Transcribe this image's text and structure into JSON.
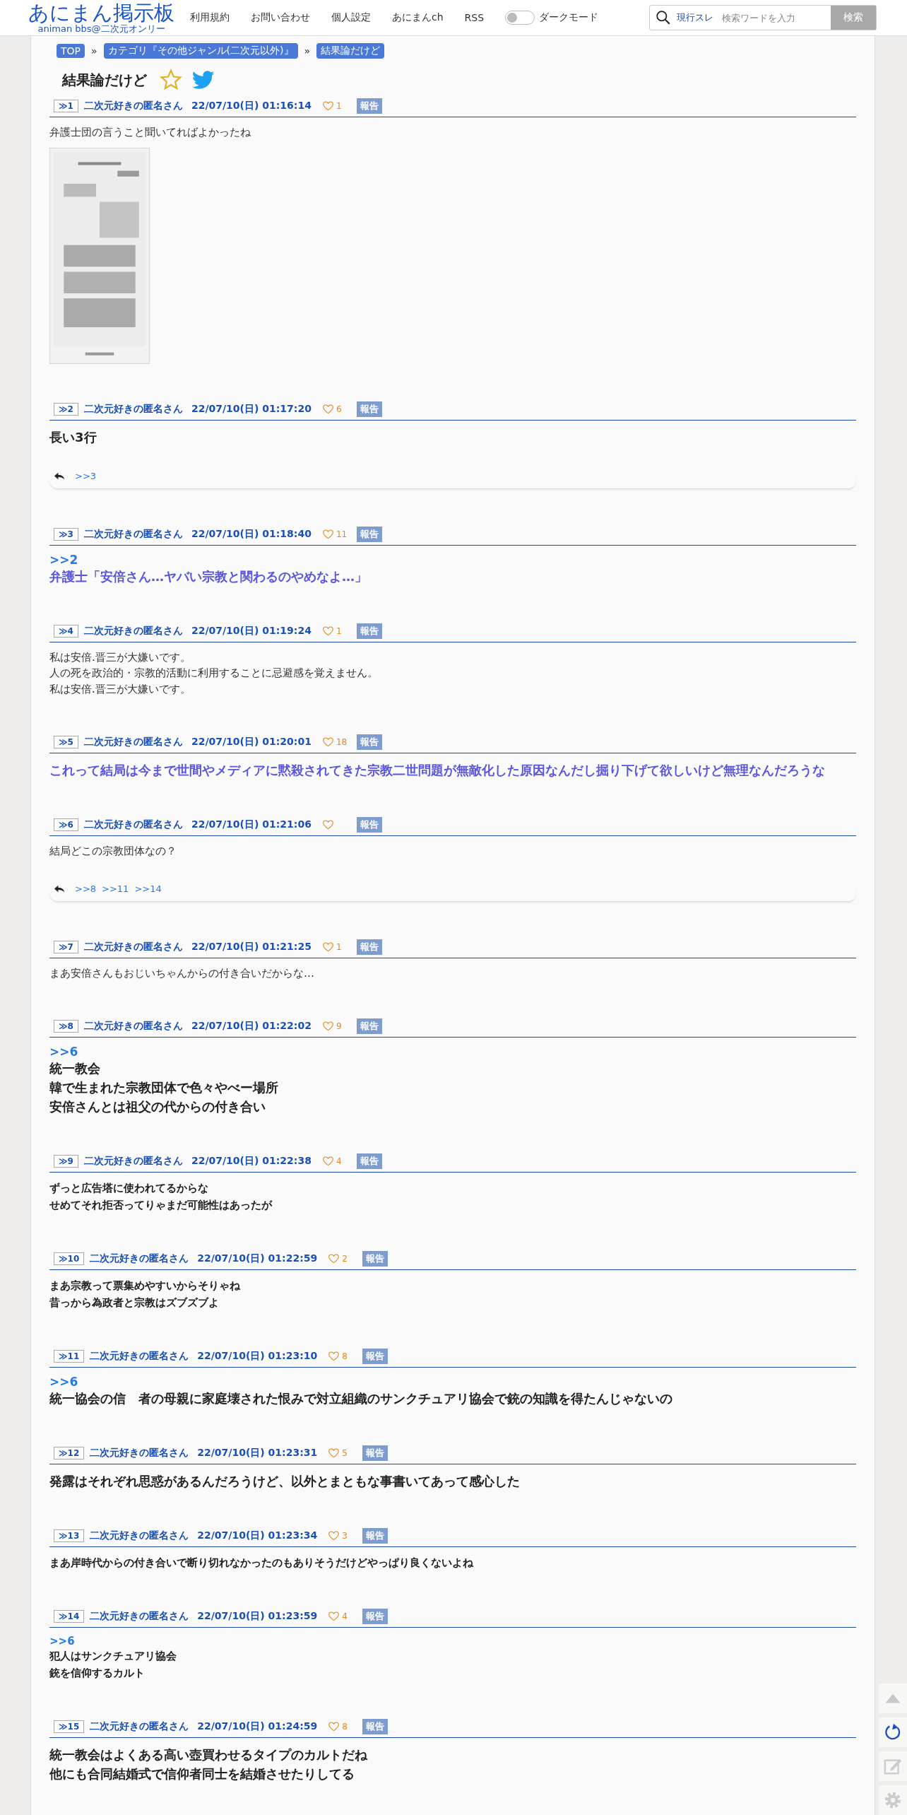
{
  "site": {
    "logo": "あにまん掲示板",
    "subtitle": "animan bbs@二次元オンリー"
  },
  "nav": [
    "利用規約",
    "お問い合わせ",
    "個人設定",
    "あにまんch",
    "RSS"
  ],
  "dark_mode": {
    "label": "ダークモード",
    "on": false
  },
  "search": {
    "scope": "現行スレ",
    "placeholder": "検索ワードを入力",
    "button": "検索"
  },
  "breadcrumbs": [
    {
      "kind": "link",
      "label": "TOP"
    },
    {
      "kind": "sep",
      "label": "»"
    },
    {
      "kind": "link",
      "label": "カテゴリ『その他ジャンル(二次元以外)』"
    },
    {
      "kind": "sep",
      "label": "»"
    },
    {
      "kind": "link",
      "label": "結果論だけど"
    }
  ],
  "thread_title": "結果論だけど",
  "posts": [
    {
      "no": "≫1",
      "name": "二次元好きの匿名さん",
      "date": "22/07/10(日) 01:16:14",
      "likes": "1",
      "report": "報告",
      "kind": "plain",
      "lines": [
        "弁護士団の言うこと聞いてればよかったね"
      ],
      "image": {
        "kind": "picture"
      }
    },
    {
      "no": "≫2",
      "name": "二次元好きの匿名さん",
      "date": "22/07/10(日) 01:17:20",
      "likes": "6",
      "report": "報告",
      "kind": "large",
      "lines": [
        "長い3行"
      ],
      "replies": [
        ">>3"
      ]
    },
    {
      "no": "≫3",
      "name": "二次元好きの匿名さん",
      "date": "22/07/10(日) 01:18:40",
      "likes": "11",
      "report": "報告",
      "kind": "highlight",
      "anchor": ">>2",
      "lines": [
        "弁護士「安倍さん…ヤバい宗教と関わるのやめなよ…」"
      ]
    },
    {
      "no": "≫4",
      "name": "二次元好きの匿名さん",
      "date": "22/07/10(日) 01:19:24",
      "likes": "1",
      "report": "報告",
      "kind": "plain",
      "lines": [
        "私は安倍.晋三が大嫌いです。",
        "人の死を政治的・宗教的活動に利用することに忌避感を覚えません。",
        "私は安倍.晋三が大嫌いです。"
      ]
    },
    {
      "no": "≫5",
      "name": "二次元好きの匿名さん",
      "date": "22/07/10(日) 01:20:01",
      "likes": "18",
      "report": "報告",
      "kind": "highlight",
      "lines": [
        "これって結局は今まで世間やメディアに黙殺されてきた宗教二世問題が無敵化した原因なんだし掘り下げて欲しいけど無理なんだろうな"
      ]
    },
    {
      "no": "≫6",
      "name": "二次元好きの匿名さん",
      "date": "22/07/10(日) 01:21:06",
      "report": "報告",
      "kind": "plain",
      "lines": [
        "結局どこの宗教団体なの？"
      ],
      "replies": [
        ">>8",
        ">>11",
        ">>14"
      ]
    },
    {
      "no": "≫7",
      "name": "二次元好きの匿名さん",
      "date": "22/07/10(日) 01:21:25",
      "likes": "1",
      "report": "報告",
      "kind": "plain",
      "lines": [
        "まあ安倍さんもおじいちゃんからの付き合いだからな…"
      ]
    },
    {
      "no": "≫8",
      "name": "二次元好きの匿名さん",
      "date": "22/07/10(日) 01:22:02",
      "likes": "9",
      "report": "報告",
      "kind": "large",
      "anchor": ">>6",
      "lines": [
        "統一教会",
        "韓で生まれた宗教団体で色々やべー場所",
        "安倍さんとは祖父の代からの付き合い"
      ]
    },
    {
      "no": "≫9",
      "name": "二次元好きの匿名さん",
      "date": "22/07/10(日) 01:22:38",
      "likes": "4",
      "report": "報告",
      "kind": "bold",
      "lines": [
        "ずっと広告塔に使われてるからな",
        "せめてそれ拒否ってりゃまだ可能性はあったが"
      ]
    },
    {
      "no": "≫10",
      "name": "二次元好きの匿名さん",
      "date": "22/07/10(日) 01:22:59",
      "likes": "2",
      "report": "報告",
      "kind": "bold",
      "lines": [
        "まあ宗教って票集めやすいからそりゃね",
        "昔っから為政者と宗教はズブズブよ"
      ]
    },
    {
      "no": "≫11",
      "name": "二次元好きの匿名さん",
      "date": "22/07/10(日) 01:23:10",
      "likes": "8",
      "report": "報告",
      "kind": "large",
      "anchor": ">>6",
      "lines": [
        "統一協会の信　者の母親に家庭壊された恨みで対立組織のサンクチュアリ協会で銃の知識を得たんじゃないの"
      ]
    },
    {
      "no": "≫12",
      "name": "二次元好きの匿名さん",
      "date": "22/07/10(日) 01:23:31",
      "likes": "5",
      "report": "報告",
      "kind": "large",
      "lines": [
        "発露はそれぞれ思惑があるんだろうけど、以外とまともな事書いてあって感心した"
      ]
    },
    {
      "no": "≫13",
      "name": "二次元好きの匿名さん",
      "date": "22/07/10(日) 01:23:34",
      "likes": "3",
      "report": "報告",
      "kind": "bold",
      "lines": [
        "まあ岸時代からの付き合いで断り切れなかったのもありそうだけどやっぱり良くないよね"
      ]
    },
    {
      "no": "≫14",
      "name": "二次元好きの匿名さん",
      "date": "22/07/10(日) 01:23:59",
      "likes": "4",
      "report": "報告",
      "kind": "bold",
      "anchor": ">>6",
      "lines": [
        "犯人はサンクチュアリ協会",
        "銃を信仰するカルト"
      ]
    },
    {
      "no": "≫15",
      "name": "二次元好きの匿名さん",
      "date": "22/07/10(日) 01:24:59",
      "likes": "8",
      "report": "報告",
      "kind": "large",
      "lines": [
        "統一教会はよくある高い壺買わせるタイプのカルトだね",
        "他にも合同結婚式で信仰者同士を結婚させたりしてる"
      ]
    }
  ]
}
